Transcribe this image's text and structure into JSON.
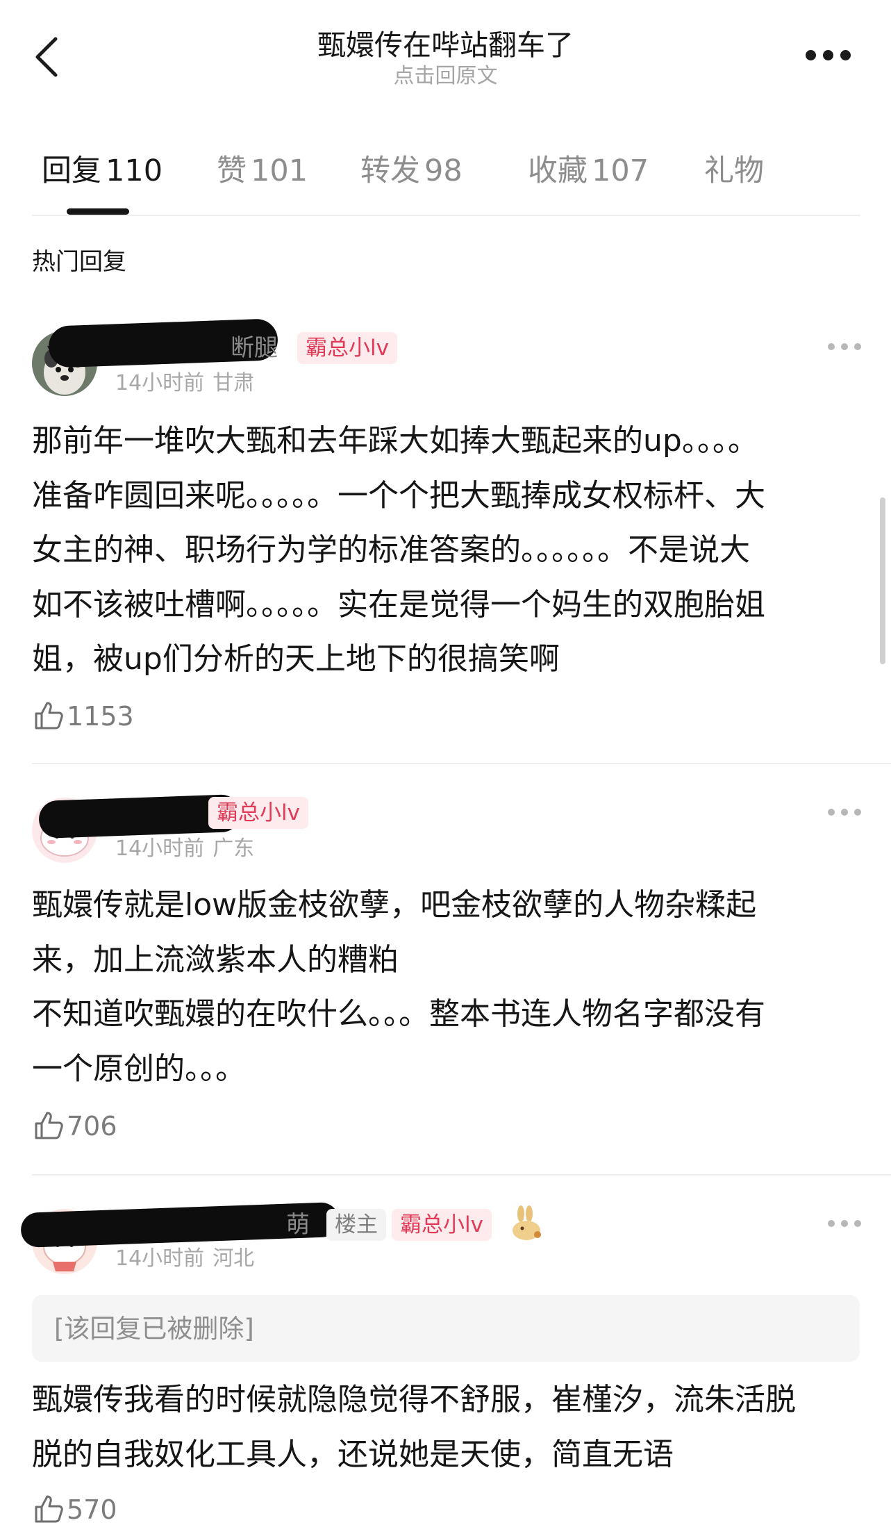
{
  "header": {
    "title": "甄嬛传在哔站翻车了",
    "subtitle": "点击回原文"
  },
  "tabs": [
    {
      "label": "回复",
      "count": "110",
      "active": true
    },
    {
      "label": "赞",
      "count": "101",
      "active": false
    },
    {
      "label": "转发",
      "count": "98",
      "active": false
    },
    {
      "label": "收藏",
      "count": "107",
      "active": false
    },
    {
      "label": "礼物",
      "count": "",
      "active": false
    }
  ],
  "section_title": "热门回复",
  "comments": [
    {
      "name_visible": "断腿",
      "badges": [
        "霸总小lv"
      ],
      "time": "14小时前",
      "location": "甘肃",
      "content": "那前年一堆吹大甄和去年踩大如捧大甄起来的up。。。。\n准备咋圆回来呢。。。。。一个个把大甄捧成女权标杆、大\n女主的神、职场行为学的标准答案的。。。。。。不是说大\n如不该被吐槽啊。。。。。实在是觉得一个妈生的双胞胎姐\n姐，被up们分析的天上地下的很搞笑啊",
      "likes": "1153"
    },
    {
      "name_visible": "",
      "badges": [
        "霸总小lv"
      ],
      "time": "14小时前",
      "location": "广东",
      "content": "甄嬛传就是low版金枝欲孽，吧金枝欲孽的人物杂糅起\n来，加上流潋紫本人的糟粕\n不知道吹甄嬛的在吹什么。。。整本书连人物名字都没有\n一个原创的。。。",
      "likes": "706"
    },
    {
      "name_visible": "萌",
      "owner_badge": "楼主",
      "badges": [
        "霸总小lv"
      ],
      "time": "14小时前",
      "location": "河北",
      "deleted_reply": "[该回复已被删除]",
      "content": "甄嬛传我看的时候就隐隐觉得不舒服，崔槿汐，流朱活脱\n脱的自我奴化工具人，还说她是天使，简直无语",
      "likes": "570"
    }
  ],
  "colors": {
    "badge_red": "#e03a57",
    "badge_red_bg": "#fdebee",
    "text_primary": "#161616",
    "text_secondary": "#a7a7a7"
  },
  "icons": [
    "back-arrow-icon",
    "more-dots-icon",
    "thumbs-up-icon",
    "rabbit-emoji-icon"
  ]
}
